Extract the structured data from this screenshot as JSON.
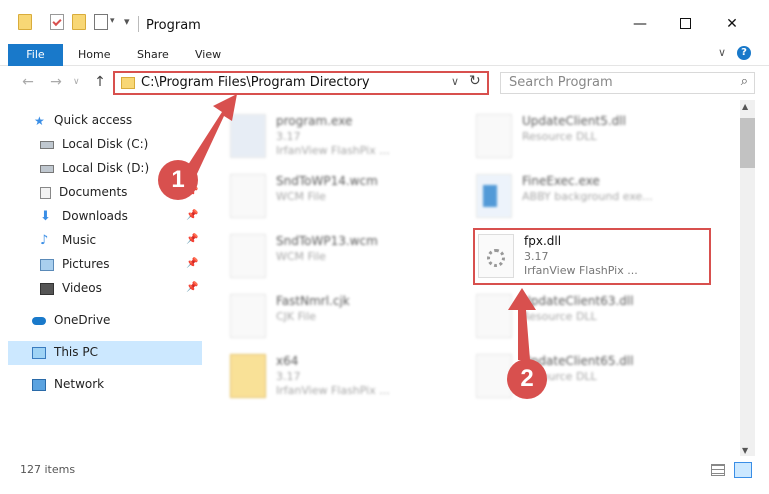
{
  "titlebar": {
    "title": "Program",
    "minimize_icon": "minimize-icon",
    "maximize_icon": "maximize-icon",
    "close_icon": "close-icon"
  },
  "ribbon": {
    "file": "File",
    "home": "Home",
    "share": "Share",
    "view": "View"
  },
  "address": {
    "path": "C:\\Program Files\\Program Directory"
  },
  "search": {
    "placeholder": "Search Program"
  },
  "sidebar": {
    "items": [
      {
        "label": "Quick access",
        "icon": "star-icon"
      },
      {
        "label": "Local Disk (C:)",
        "icon": "drive-icon"
      },
      {
        "label": "Local Disk (D:)",
        "icon": "drive-icon"
      },
      {
        "label": "Documents",
        "icon": "documents-icon"
      },
      {
        "label": "Downloads",
        "icon": "downloads-icon"
      },
      {
        "label": "Music",
        "icon": "music-icon"
      },
      {
        "label": "Pictures",
        "icon": "pictures-icon"
      },
      {
        "label": "Videos",
        "icon": "videos-icon"
      },
      {
        "label": "OneDrive",
        "icon": "cloud-icon"
      },
      {
        "label": "This PC",
        "icon": "computer-icon"
      },
      {
        "label": "Network",
        "icon": "network-icon"
      }
    ]
  },
  "files": [
    {
      "name": "program.exe",
      "line2": "3.17",
      "line3": "IrfanView FlashPix ..."
    },
    {
      "name": "UpdateClient5.dll",
      "line2": "Resource DLL",
      "line3": ""
    },
    {
      "name": "SndToWP14.wcm",
      "line2": "WCM File",
      "line3": ""
    },
    {
      "name": "FineExec.exe",
      "line2": "ABBY background exe...",
      "line3": ""
    },
    {
      "name": "SndToWP13.wcm",
      "line2": "WCM File",
      "line3": ""
    },
    {
      "name": "fpx.dll",
      "line2": "3.17",
      "line3": "IrfanView FlashPix ..."
    },
    {
      "name": "FastNmrl.cjk",
      "line2": "CJK File",
      "line3": ""
    },
    {
      "name": "UpdateClient63.dll",
      "line2": "Resource DLL",
      "line3": ""
    },
    {
      "name": "x64",
      "line2": "3.17",
      "line3": "IrfanView FlashPix ..."
    },
    {
      "name": "UpdateClient65.dll",
      "line2": "Resource DLL",
      "line3": ""
    }
  ],
  "status": {
    "count": "127 items"
  },
  "callouts": {
    "one": "1",
    "two": "2"
  },
  "colors": {
    "accent": "#1979ca",
    "highlight": "#d8504e",
    "selected": "#cce8ff"
  }
}
